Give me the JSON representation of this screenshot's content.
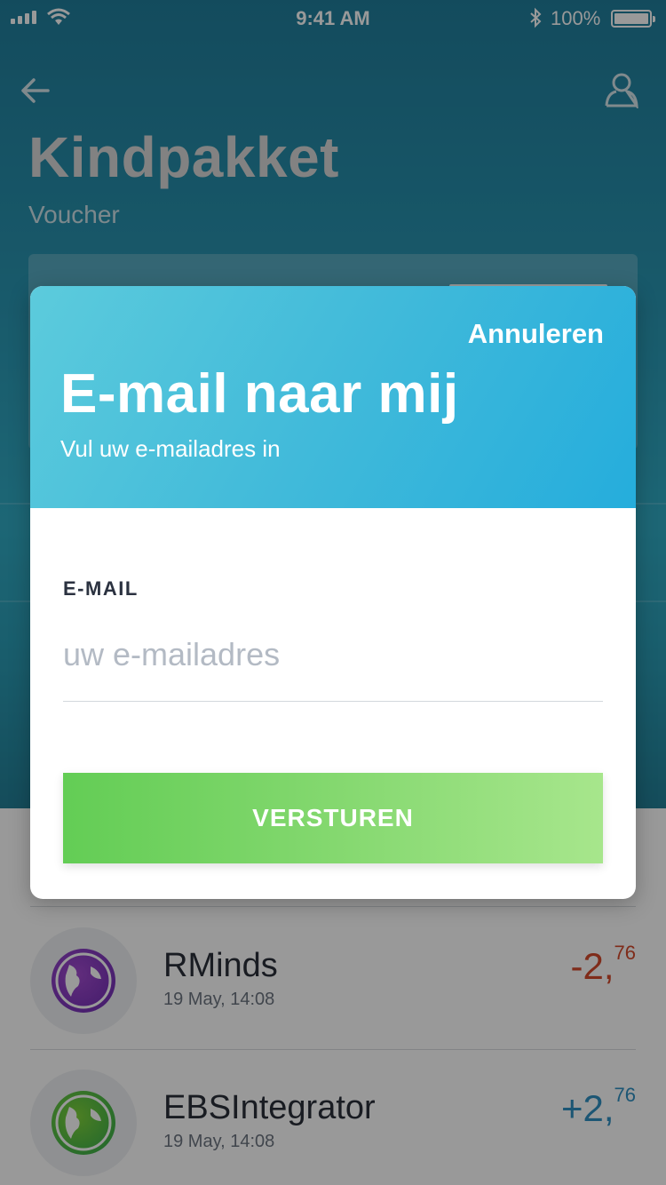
{
  "status_bar": {
    "time": "9:41 AM",
    "battery": "100%"
  },
  "header": {
    "title": "Kindpakket",
    "subtitle": "Voucher"
  },
  "transactions": [
    {
      "name": "RMinds",
      "date": "19 May, 14:08",
      "amount_main": "-2,",
      "amount_cents": "76",
      "color": "#d44a2c"
    },
    {
      "name": "EBSIntegrator",
      "date": "19 May, 14:08",
      "amount_main": "+2,",
      "amount_cents": "76",
      "color": "#2f8fc2"
    }
  ],
  "modal": {
    "cancel_label": "Annuleren",
    "title": "E-mail naar mij",
    "subtitle": "Vul uw e-mailadres in",
    "email_label": "E-MAIL",
    "email_placeholder": "uw e-mailadres",
    "email_value": "",
    "submit_label": "VERSTUREN"
  },
  "colors": {
    "accent": "#25addc",
    "button": "#7ad466",
    "negative": "#d44a2c",
    "positive": "#2f8fc2"
  }
}
